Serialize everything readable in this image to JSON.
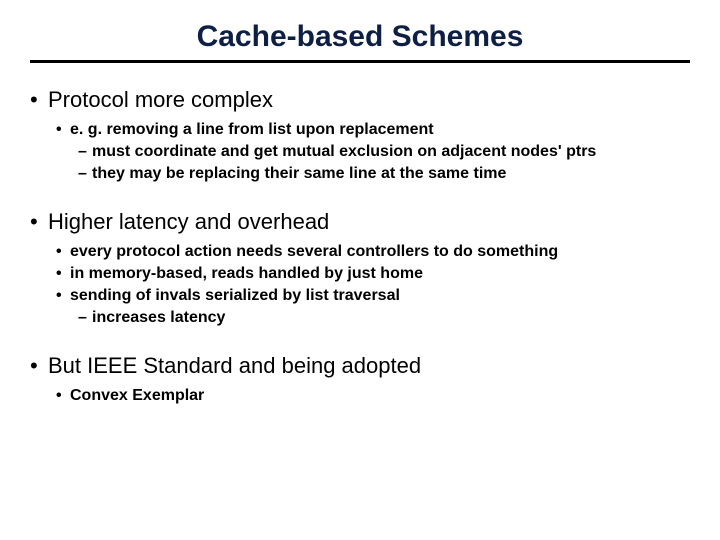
{
  "title": "Cache-based Schemes",
  "section1": {
    "heading": "Protocol more complex",
    "sub1": "e. g. removing a line from list upon replacement",
    "sub1a": "must coordinate and get mutual exclusion on adjacent nodes' ptrs",
    "sub1b": "they may be replacing their same line at the same time"
  },
  "section2": {
    "heading": "Higher latency and overhead",
    "sub1": "every protocol action needs several controllers to do something",
    "sub2": "in memory-based, reads handled by just home",
    "sub3": "sending of invals serialized by list traversal",
    "sub3a": "increases latency"
  },
  "section3": {
    "heading": "But IEEE Standard and being adopted",
    "sub1": "Convex Exemplar"
  }
}
